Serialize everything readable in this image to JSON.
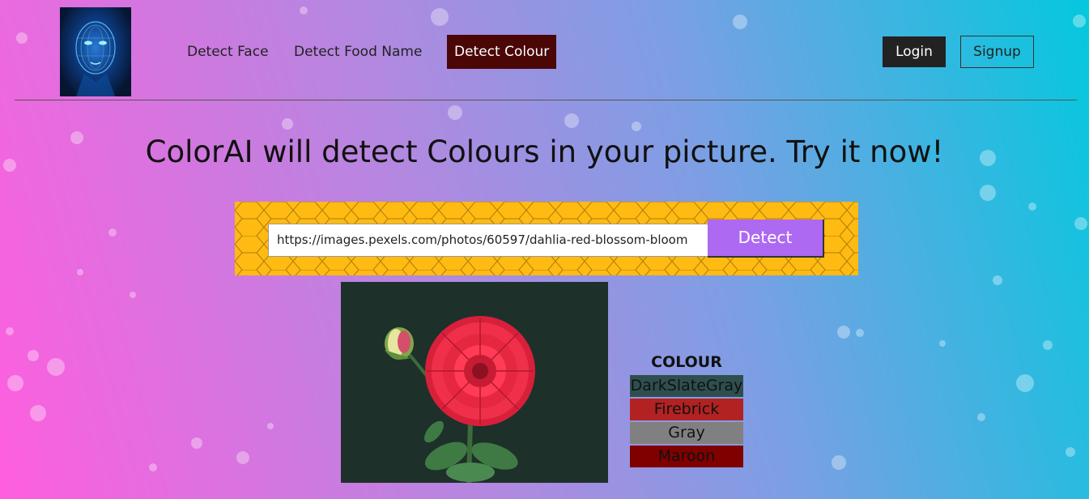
{
  "nav": {
    "links": [
      "Detect Face",
      "Detect Food Name",
      "Detect Colour"
    ],
    "active_index": 2,
    "login_label": "Login",
    "signup_label": "Signup"
  },
  "main": {
    "title": "ColorAI will detect Colours in your picture. Try it now!",
    "url_value": "https://images.pexels.com/photos/60597/dahlia-red-blossom-bloom",
    "detect_label": "Detect",
    "colour_heading": "COLOUR",
    "colours": [
      {
        "name": "DarkSlateGray",
        "hex": "#2f4f4f"
      },
      {
        "name": "Firebrick",
        "hex": "#b22222"
      },
      {
        "name": "Gray",
        "hex": "#808080"
      },
      {
        "name": "Maroon",
        "hex": "#800000"
      }
    ]
  },
  "colors": {
    "band": "#ffbb12",
    "detect_button": "#ad69f1",
    "active_nav": "#4b0606",
    "login_button": "#222222"
  }
}
